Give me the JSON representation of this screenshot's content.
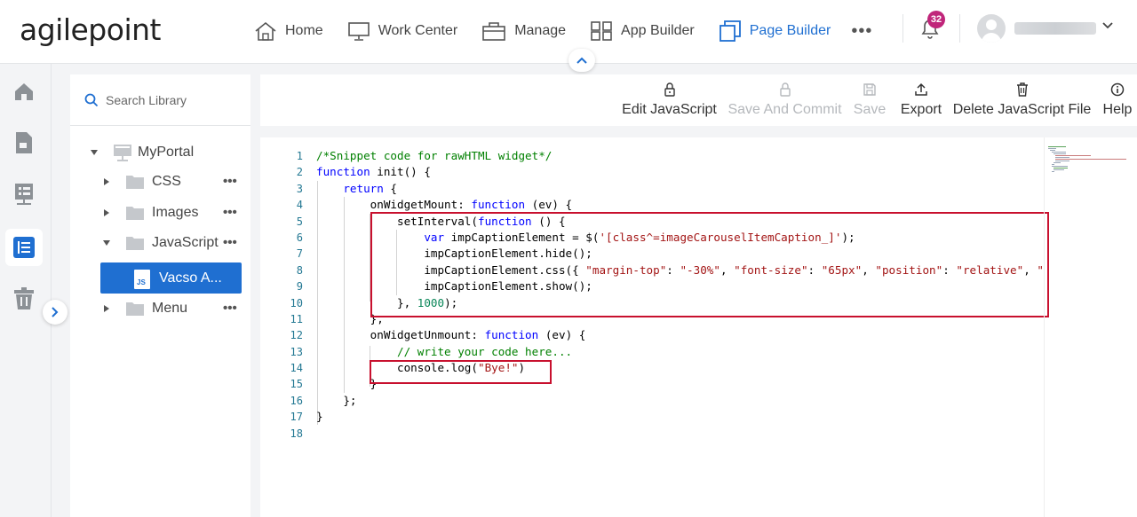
{
  "header": {
    "logo_text": "agilepoint",
    "nav": [
      {
        "label": "Home",
        "icon": "home-icon"
      },
      {
        "label": "Work Center",
        "icon": "monitor-icon"
      },
      {
        "label": "Manage",
        "icon": "briefcase-icon"
      },
      {
        "label": "App Builder",
        "icon": "grid-icon"
      },
      {
        "label": "Page Builder",
        "icon": "pages-icon",
        "active": true
      }
    ],
    "more_label": "•••",
    "notification_count": "32"
  },
  "rail": {
    "items": [
      "home-icon",
      "page-icon",
      "form-icon",
      "list-icon",
      "trash-icon"
    ]
  },
  "library": {
    "search_placeholder": "Search Library",
    "root": "MyPortal",
    "folders": [
      {
        "label": "CSS",
        "expanded": false
      },
      {
        "label": "Images",
        "expanded": false
      },
      {
        "label": "JavaScript",
        "expanded": true
      },
      {
        "label": "Menu",
        "expanded": false
      }
    ],
    "more_label": "•••",
    "selected_file": "Vacso A...",
    "file_badge": "JS"
  },
  "toolbar": {
    "edit": "Edit JavaScript",
    "save_commit": "Save And Commit",
    "save": "Save",
    "export": "Export",
    "delete": "Delete JavaScript File",
    "help": "Help"
  },
  "editor": {
    "line_numbers": [
      "1",
      "2",
      "3",
      "4",
      "5",
      "6",
      "7",
      "8",
      "9",
      "10",
      "11",
      "12",
      "13",
      "14",
      "15",
      "16",
      "17",
      "18"
    ],
    "lines": [
      "/*Snippet code for rawHTML widget*/",
      "function init() {",
      "    return {",
      "        onWidgetMount: function (ev) {",
      "            setInterval(function () {",
      "                var impCaptionElement = $('[class^=imageCarouselItemCaption_]');",
      "                impCaptionElement.hide();",
      "                impCaptionElement.css({ \"margin-top\": \"-30%\", \"font-size\": \"65px\", \"position\": \"relative\", \"ba",
      "                impCaptionElement.show();",
      "            }, 1000);",
      "        },",
      "        onWidgetUnmount: function (ev) {",
      "            // write your code here...",
      "            console.log(\"Bye!\")",
      "        }",
      "    };",
      "}",
      ""
    ]
  }
}
